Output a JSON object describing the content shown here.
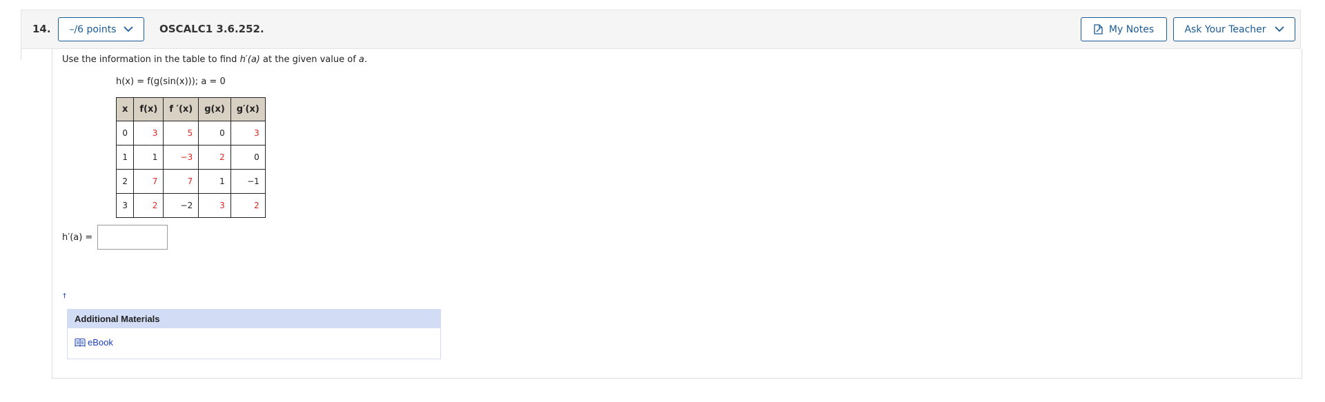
{
  "question": {
    "number": "14.",
    "points_label": "–/6 points",
    "code": "OSCALC1 3.6.252.",
    "my_notes_label": "My Notes",
    "ask_teacher_label": "Ask Your Teacher"
  },
  "problem": {
    "instruction_pre": "Use the information in the table to find ",
    "instruction_fn": "h′(a)",
    "instruction_mid": " at the given value of ",
    "instruction_var": "a",
    "instruction_end": ".",
    "function_def": "h(x) = f(g(sin(x))); a = 0"
  },
  "table": {
    "headers": [
      "x",
      "f(x)",
      "f ′(x)",
      "g(x)",
      "g′(x)"
    ],
    "rows": [
      [
        "0",
        "3",
        "5",
        "0",
        "3"
      ],
      [
        "1",
        "1",
        "−3",
        "2",
        "0"
      ],
      [
        "2",
        "7",
        "7",
        "1",
        "−1"
      ],
      [
        "3",
        "2",
        "−2",
        "3",
        "2"
      ]
    ],
    "red_cells": [
      [
        false,
        true,
        true,
        false,
        true
      ],
      [
        false,
        false,
        true,
        true,
        false
      ],
      [
        false,
        true,
        true,
        false,
        false
      ],
      [
        false,
        true,
        false,
        true,
        true
      ]
    ]
  },
  "answer": {
    "label": "h′(a) =",
    "value": ""
  },
  "additional_materials": {
    "title": "Additional Materials",
    "ebook_label": "eBook"
  },
  "colors": {
    "accent": "#1a5a96",
    "red_value": "#e0261f",
    "table_header_bg": "#d8d1c3",
    "materials_header_bg": "#d3dcf5"
  },
  "icons": {
    "points_chevron": "chevron-down-icon",
    "notes": "notes-icon",
    "ask_chevron": "chevron-down-icon",
    "ebook": "book-icon",
    "link_marker": "dagger-icon"
  }
}
